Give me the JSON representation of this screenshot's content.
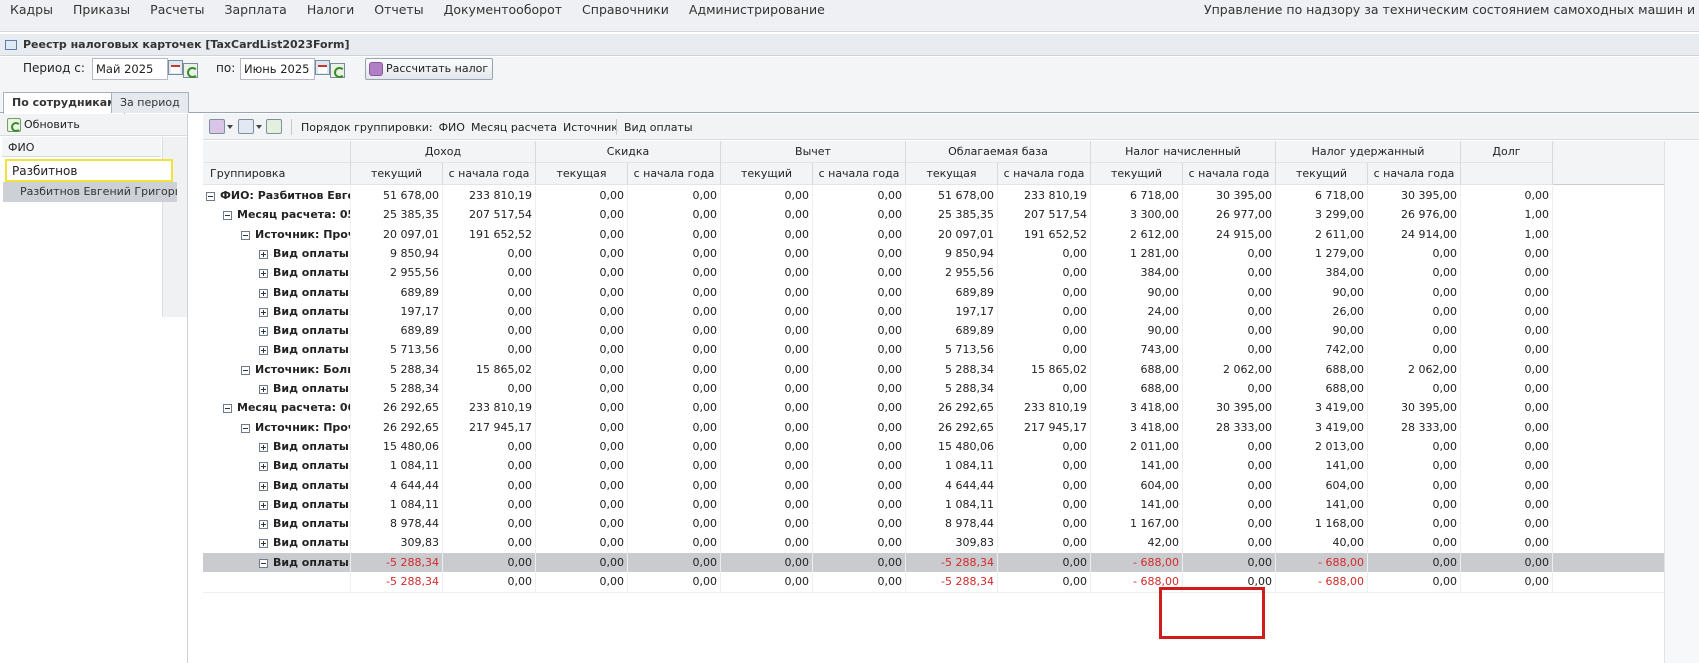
{
  "menu": {
    "items": [
      "Кадры",
      "Приказы",
      "Расчеты",
      "Зарплата",
      "Налоги",
      "Отчеты",
      "Документооборот",
      "Справочники",
      "Администрирование"
    ],
    "org": "Управление по надзору за техническим состоянием самоходных машин и других видов"
  },
  "window": {
    "title": "Реестр налоговых карточек [TaxCardList2023Form]"
  },
  "period": {
    "from_label": "Период с:",
    "from_value": "Май 2025",
    "to_label": "по:",
    "to_value": "Июнь 2025",
    "calc_button": "Рассчитать налог"
  },
  "tabs": [
    "По сотрудникам",
    "За период"
  ],
  "left": {
    "refresh": "Обновить",
    "fio_header": "ФИО",
    "fio_filter": "Разбитнов",
    "result": "Разбитнов Евгений Григорь..."
  },
  "toolbar": {
    "group_order_label": "Порядок группировки:",
    "group_items": [
      "ФИО",
      "Месяц расчета",
      "Источник",
      "Вид оплаты"
    ]
  },
  "grid": {
    "group_col": "Группировка",
    "groups": [
      "Доход",
      "Скидка",
      "Вычет",
      "Облагаемая база",
      "Налог начисленный",
      "Налог удержанный",
      "Долг"
    ],
    "sub_current": "текущий",
    "sub_current_f": "текущая",
    "sub_ytd": "с начала года",
    "rows": [
      {
        "label": "ФИО: Разбитнов Евге...",
        "level": 0,
        "toggle": "minus",
        "v": [
          "51 678,00",
          "233 810,19",
          "0,00",
          "0,00",
          "0,00",
          "0,00",
          "51 678,00",
          "233 810,19",
          "6 718,00",
          "30 395,00",
          "6 718,00",
          "30 395,00",
          "0,00"
        ]
      },
      {
        "label": "Месяц расчета: 05....",
        "level": 1,
        "toggle": "minus",
        "v": [
          "25 385,35",
          "207 517,54",
          "0,00",
          "0,00",
          "0,00",
          "0,00",
          "25 385,35",
          "207 517,54",
          "3 300,00",
          "26 977,00",
          "3 299,00",
          "26 976,00",
          "1,00"
        ]
      },
      {
        "label": "Источник: Проч...",
        "level": 2,
        "toggle": "minus",
        "v": [
          "20 097,01",
          "191 652,52",
          "0,00",
          "0,00",
          "0,00",
          "0,00",
          "20 097,01",
          "191 652,52",
          "2 612,00",
          "24 915,00",
          "2 611,00",
          "24 914,00",
          "1,00"
        ]
      },
      {
        "label": "Вид оплаты:...",
        "level": 3,
        "toggle": "plus",
        "v": [
          "9 850,94",
          "0,00",
          "0,00",
          "0,00",
          "0,00",
          "0,00",
          "9 850,94",
          "0,00",
          "1 281,00",
          "0,00",
          "1 279,00",
          "0,00",
          "0,00"
        ]
      },
      {
        "label": "Вид оплаты:...",
        "level": 3,
        "toggle": "plus",
        "v": [
          "2 955,56",
          "0,00",
          "0,00",
          "0,00",
          "0,00",
          "0,00",
          "2 955,56",
          "0,00",
          "384,00",
          "0,00",
          "384,00",
          "0,00",
          "0,00"
        ]
      },
      {
        "label": "Вид оплаты:...",
        "level": 3,
        "toggle": "plus",
        "v": [
          "689,89",
          "0,00",
          "0,00",
          "0,00",
          "0,00",
          "0,00",
          "689,89",
          "0,00",
          "90,00",
          "0,00",
          "90,00",
          "0,00",
          "0,00"
        ]
      },
      {
        "label": "Вид оплаты:...",
        "level": 3,
        "toggle": "plus",
        "v": [
          "197,17",
          "0,00",
          "0,00",
          "0,00",
          "0,00",
          "0,00",
          "197,17",
          "0,00",
          "24,00",
          "0,00",
          "26,00",
          "0,00",
          "0,00"
        ]
      },
      {
        "label": "Вид оплаты:...",
        "level": 3,
        "toggle": "plus",
        "v": [
          "689,89",
          "0,00",
          "0,00",
          "0,00",
          "0,00",
          "0,00",
          "689,89",
          "0,00",
          "90,00",
          "0,00",
          "90,00",
          "0,00",
          "0,00"
        ]
      },
      {
        "label": "Вид оплаты:...",
        "level": 3,
        "toggle": "plus",
        "v": [
          "5 713,56",
          "0,00",
          "0,00",
          "0,00",
          "0,00",
          "0,00",
          "5 713,56",
          "0,00",
          "743,00",
          "0,00",
          "742,00",
          "0,00",
          "0,00"
        ]
      },
      {
        "label": "Источник: Боль...",
        "level": 2,
        "toggle": "minus",
        "v": [
          "5 288,34",
          "15 865,02",
          "0,00",
          "0,00",
          "0,00",
          "0,00",
          "5 288,34",
          "15 865,02",
          "688,00",
          "2 062,00",
          "688,00",
          "2 062,00",
          "0,00"
        ]
      },
      {
        "label": "Вид оплаты:...",
        "level": 3,
        "toggle": "plus",
        "v": [
          "5 288,34",
          "0,00",
          "0,00",
          "0,00",
          "0,00",
          "0,00",
          "5 288,34",
          "0,00",
          "688,00",
          "0,00",
          "688,00",
          "0,00",
          "0,00"
        ]
      },
      {
        "label": "Месяц расчета: 06....",
        "level": 1,
        "toggle": "minus",
        "v": [
          "26 292,65",
          "233 810,19",
          "0,00",
          "0,00",
          "0,00",
          "0,00",
          "26 292,65",
          "233 810,19",
          "3 418,00",
          "30 395,00",
          "3 419,00",
          "30 395,00",
          "0,00"
        ]
      },
      {
        "label": "Источник: Проч...",
        "level": 2,
        "toggle": "minus",
        "v": [
          "26 292,65",
          "217 945,17",
          "0,00",
          "0,00",
          "0,00",
          "0,00",
          "26 292,65",
          "217 945,17",
          "3 418,00",
          "28 333,00",
          "3 419,00",
          "28 333,00",
          "0,00"
        ]
      },
      {
        "label": "Вид оплаты:...",
        "level": 3,
        "toggle": "plus",
        "v": [
          "15 480,06",
          "0,00",
          "0,00",
          "0,00",
          "0,00",
          "0,00",
          "15 480,06",
          "0,00",
          "2 011,00",
          "0,00",
          "2 013,00",
          "0,00",
          "0,00"
        ]
      },
      {
        "label": "Вид оплаты:...",
        "level": 3,
        "toggle": "plus",
        "v": [
          "1 084,11",
          "0,00",
          "0,00",
          "0,00",
          "0,00",
          "0,00",
          "1 084,11",
          "0,00",
          "141,00",
          "0,00",
          "141,00",
          "0,00",
          "0,00"
        ]
      },
      {
        "label": "Вид оплаты:...",
        "level": 3,
        "toggle": "plus",
        "v": [
          "4 644,44",
          "0,00",
          "0,00",
          "0,00",
          "0,00",
          "0,00",
          "4 644,44",
          "0,00",
          "604,00",
          "0,00",
          "604,00",
          "0,00",
          "0,00"
        ]
      },
      {
        "label": "Вид оплаты:...",
        "level": 3,
        "toggle": "plus",
        "v": [
          "1 084,11",
          "0,00",
          "0,00",
          "0,00",
          "0,00",
          "0,00",
          "1 084,11",
          "0,00",
          "141,00",
          "0,00",
          "141,00",
          "0,00",
          "0,00"
        ]
      },
      {
        "label": "Вид оплаты:...",
        "level": 3,
        "toggle": "plus",
        "v": [
          "8 978,44",
          "0,00",
          "0,00",
          "0,00",
          "0,00",
          "0,00",
          "8 978,44",
          "0,00",
          "1 167,00",
          "0,00",
          "1 168,00",
          "0,00",
          "0,00"
        ]
      },
      {
        "label": "Вид оплаты:...",
        "level": 3,
        "toggle": "plus",
        "v": [
          "309,83",
          "0,00",
          "0,00",
          "0,00",
          "0,00",
          "0,00",
          "309,83",
          "0,00",
          "42,00",
          "0,00",
          "40,00",
          "0,00",
          "0,00"
        ]
      },
      {
        "label": "Вид оплаты:...",
        "level": 3,
        "toggle": "minus",
        "selected": true,
        "v": [
          "-5 288,34",
          "0,00",
          "0,00",
          "0,00",
          "0,00",
          "0,00",
          "-5 288,34",
          "0,00",
          "- 688,00",
          "0,00",
          "- 688,00",
          "0,00",
          "0,00"
        ]
      },
      {
        "label": "",
        "level": 4,
        "toggle": "none",
        "v": [
          "-5 288,34",
          "0,00",
          "0,00",
          "0,00",
          "0,00",
          "0,00",
          "-5 288,34",
          "0,00",
          "- 688,00",
          "0,00",
          "- 688,00",
          "0,00",
          "0,00"
        ]
      }
    ]
  },
  "colors": {
    "negative": "#d42a2a",
    "highlight": "#d01c1c",
    "filter_border": "#f2e23a"
  }
}
